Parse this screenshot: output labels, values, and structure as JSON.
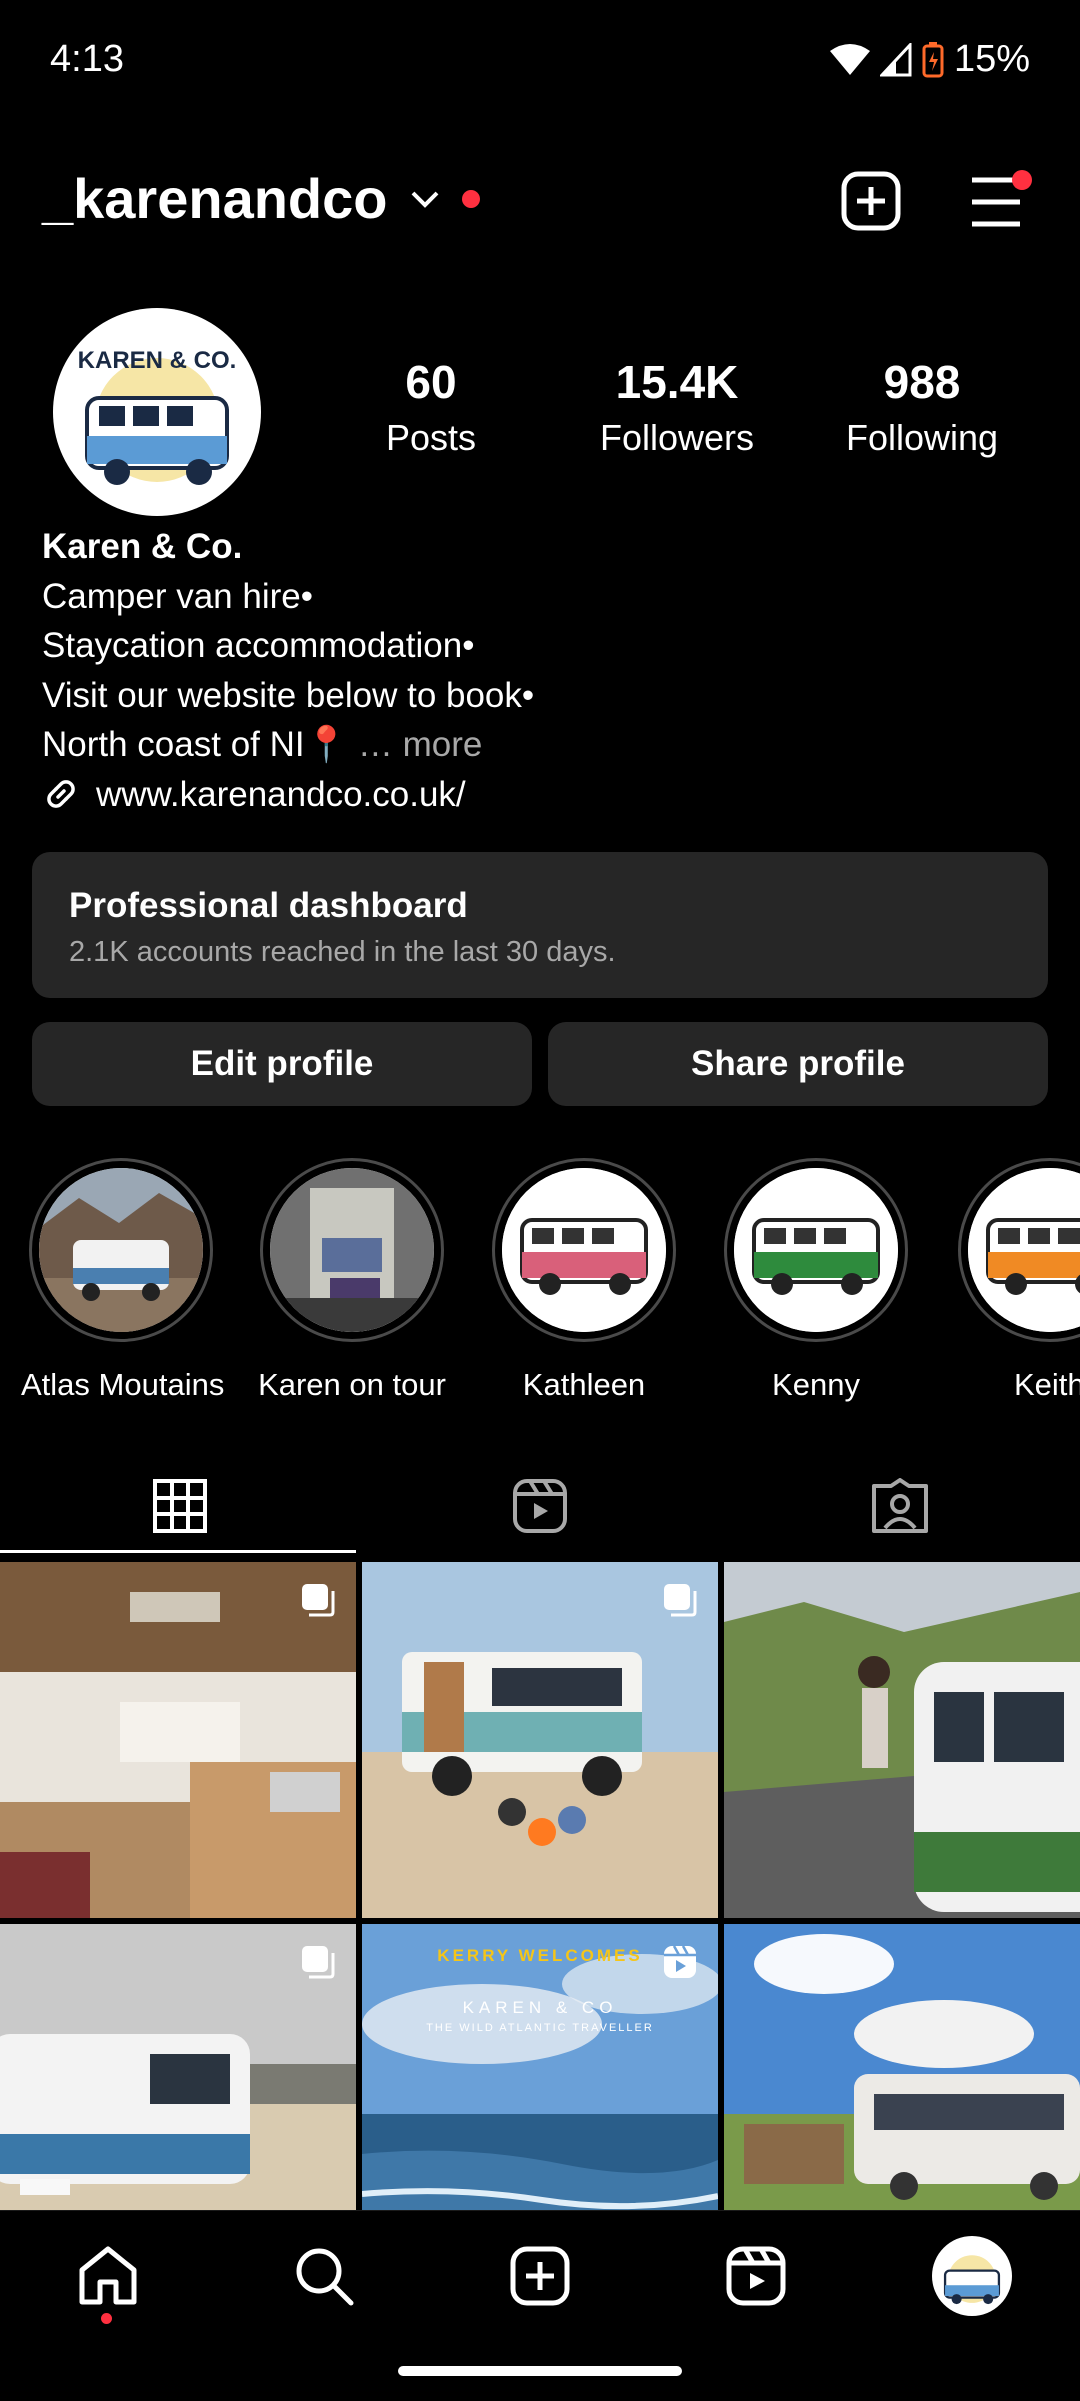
{
  "status": {
    "time": "4:13",
    "battery": "15%"
  },
  "header": {
    "username": "_karenandco"
  },
  "profile": {
    "stats": [
      {
        "value": "60",
        "label": "Posts"
      },
      {
        "value": "15.4K",
        "label": "Followers"
      },
      {
        "value": "988",
        "label": "Following"
      }
    ],
    "avatar_text": "KAREN & CO.",
    "name": "Karen & Co.",
    "bio_lines": [
      "Camper van hire•",
      "Staycation accommodation•",
      "Visit our website below to book•",
      "North coast of NI📍"
    ],
    "more": "… more",
    "link": "www.karenandco.co.uk/"
  },
  "dashboard": {
    "title": "Professional dashboard",
    "subtitle": "2.1K accounts reached in the last 30 days."
  },
  "buttons": {
    "edit": "Edit profile",
    "share": "Share profile"
  },
  "highlights": [
    {
      "label": "Atlas Moutains"
    },
    {
      "label": "Karen on tour"
    },
    {
      "label": "Kathleen",
      "van_color": "#d9607a"
    },
    {
      "label": "Kenny",
      "van_color": "#2e8b3d"
    },
    {
      "label": "Keith",
      "van_color": "#f08a24"
    }
  ],
  "tabs": [
    {
      "icon": "grid-icon"
    },
    {
      "icon": "reels-icon"
    },
    {
      "icon": "tagged-icon"
    }
  ],
  "posts": [
    {
      "scene": "camper-interior",
      "type": "carousel"
    },
    {
      "scene": "beach-campfire",
      "type": "carousel"
    },
    {
      "scene": "mountain-road",
      "type": "photo"
    },
    {
      "scene": "white-camper-beach",
      "type": "carousel"
    },
    {
      "scene": "atlantic-ocean",
      "type": "reel",
      "overlay_title": "KERRY WELCOMES",
      "overlay_sub1": "KAREN & CO",
      "overlay_sub2": "THE WILD ATLANTIC TRAVELLER"
    },
    {
      "scene": "bus-field",
      "type": "photo"
    }
  ],
  "nav": [
    {
      "icon": "home-icon"
    },
    {
      "icon": "search-icon"
    },
    {
      "icon": "create-icon"
    },
    {
      "icon": "reels-icon"
    },
    {
      "icon": "profile-avatar"
    }
  ],
  "colors": {
    "accent_red": "#ff3040",
    "card_bg": "#262626",
    "muted": "#a8a8a8"
  }
}
